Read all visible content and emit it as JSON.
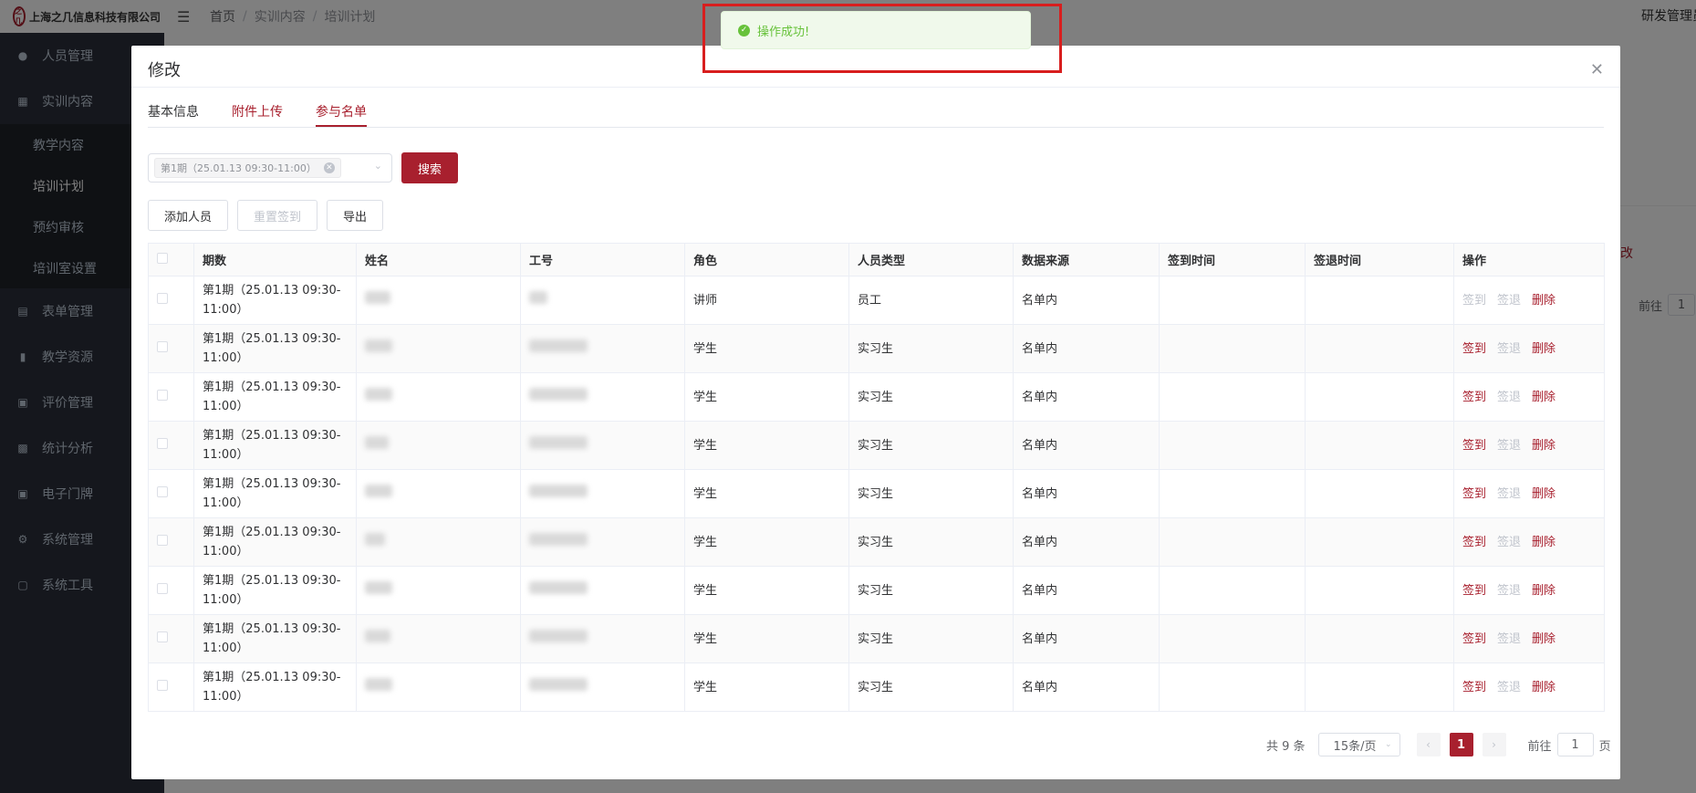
{
  "app": {
    "company": "上海之几信息科技有限公司",
    "logo_mark": "之几",
    "user_label": "研发管理员"
  },
  "breadcrumb": [
    "首页",
    "实训内容",
    "培训计划"
  ],
  "sidebar": {
    "items": [
      {
        "label": "人员管理",
        "icon": "users-icon"
      },
      {
        "label": "实训内容",
        "icon": "book-icon"
      },
      {
        "label": "表单管理",
        "icon": "form-icon"
      },
      {
        "label": "教学资源",
        "icon": "resource-icon"
      },
      {
        "label": "评价管理",
        "icon": "rating-icon"
      },
      {
        "label": "统计分析",
        "icon": "chart-icon"
      },
      {
        "label": "电子门牌",
        "icon": "monitor-icon"
      },
      {
        "label": "系统管理",
        "icon": "gear-icon"
      },
      {
        "label": "系统工具",
        "icon": "toolbox-icon"
      }
    ],
    "subitems": [
      {
        "label": "教学内容"
      },
      {
        "label": "培训计划"
      },
      {
        "label": "预约审核"
      },
      {
        "label": "培训室设置"
      }
    ]
  },
  "background": {
    "right_text": "改",
    "goto_label": "前往",
    "goto_value": "1"
  },
  "toast": {
    "message": "操作成功!"
  },
  "dialog": {
    "title": "修改",
    "tabs": [
      {
        "label": "基本信息"
      },
      {
        "label": "附件上传"
      },
      {
        "label": "参与名单"
      }
    ],
    "filter": {
      "tag": "第1期（25.01.13 09:30-11:00）",
      "search_label": "搜索"
    },
    "toolbar": {
      "add_label": "添加人员",
      "reset_label": "重置签到",
      "export_label": "导出"
    },
    "table": {
      "columns": [
        "期数",
        "姓名",
        "工号",
        "角色",
        "人员类型",
        "数据来源",
        "签到时间",
        "签退时间",
        "操作"
      ],
      "rows": [
        {
          "period": "第1期（25.01.13 09:30-11:00）",
          "role": "讲师",
          "type": "员工",
          "source": "名单内",
          "checkin": "",
          "checkout": "",
          "signin_enabled": false
        },
        {
          "period": "第1期（25.01.13 09:30-11:00）",
          "role": "学生",
          "type": "实习生",
          "source": "名单内",
          "checkin": "",
          "checkout": "",
          "signin_enabled": true
        },
        {
          "period": "第1期（25.01.13 09:30-11:00）",
          "role": "学生",
          "type": "实习生",
          "source": "名单内",
          "checkin": "",
          "checkout": "",
          "signin_enabled": true
        },
        {
          "period": "第1期（25.01.13 09:30-11:00）",
          "role": "学生",
          "type": "实习生",
          "source": "名单内",
          "checkin": "",
          "checkout": "",
          "signin_enabled": true
        },
        {
          "period": "第1期（25.01.13 09:30-11:00）",
          "role": "学生",
          "type": "实习生",
          "source": "名单内",
          "checkin": "",
          "checkout": "",
          "signin_enabled": true
        },
        {
          "period": "第1期（25.01.13 09:30-11:00）",
          "role": "学生",
          "type": "实习生",
          "source": "名单内",
          "checkin": "",
          "checkout": "",
          "signin_enabled": true
        },
        {
          "period": "第1期（25.01.13 09:30-11:00）",
          "role": "学生",
          "type": "实习生",
          "source": "名单内",
          "checkin": "",
          "checkout": "",
          "signin_enabled": true
        },
        {
          "period": "第1期（25.01.13 09:30-11:00）",
          "role": "学生",
          "type": "实习生",
          "source": "名单内",
          "checkin": "",
          "checkout": "",
          "signin_enabled": true
        },
        {
          "period": "第1期（25.01.13 09:30-11:00）",
          "role": "学生",
          "type": "实习生",
          "source": "名单内",
          "checkin": "",
          "checkout": "",
          "signin_enabled": true
        }
      ],
      "actions": {
        "signin": "签到",
        "signout": "签退",
        "delete": "删除"
      }
    },
    "pagination": {
      "total": "共 9 条",
      "page_size": "15条/页",
      "current_page": "1",
      "goto_label": "前往",
      "goto_value": "1",
      "page_unit": "页"
    }
  },
  "colors": {
    "accent": "#a8202e",
    "success": "#67c23a",
    "sidebar": "#2b2f3a"
  }
}
